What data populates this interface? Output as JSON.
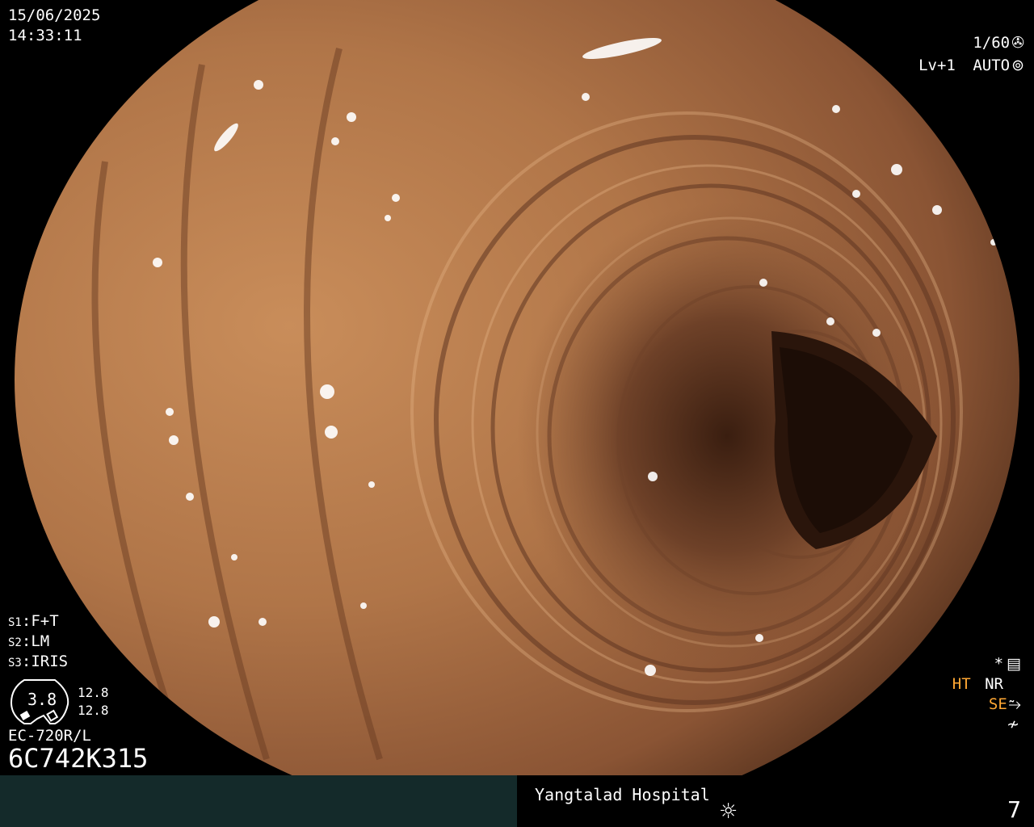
{
  "overlay": {
    "date": "15/06/2025",
    "time": "14:33:11",
    "shutter": "1/60",
    "shutter_icon": "aperture-icon",
    "level": "Lv+1",
    "mode": "AUTO",
    "mode_icon": "auto-iris-icon",
    "settings": [
      {
        "key": "S1",
        "value": "F+T"
      },
      {
        "key": "S2",
        "value": "LM"
      },
      {
        "key": "S3",
        "value": "IRIS"
      }
    ],
    "gauge_value": "3.8",
    "gauge_right_top": "12.8",
    "gauge_right_bottom": "12.8",
    "scope_model": "EC-720R/L",
    "serial": "6C742K315",
    "right_status": {
      "star": "*",
      "ht": "HT",
      "nr": "NR",
      "se": "SE",
      "ht_color": "#ffa733",
      "se_color": "#ffa733"
    }
  },
  "footer": {
    "hospital": "Yangtalad Hospital",
    "light_icon": "sun-icon",
    "image_number": "7"
  }
}
